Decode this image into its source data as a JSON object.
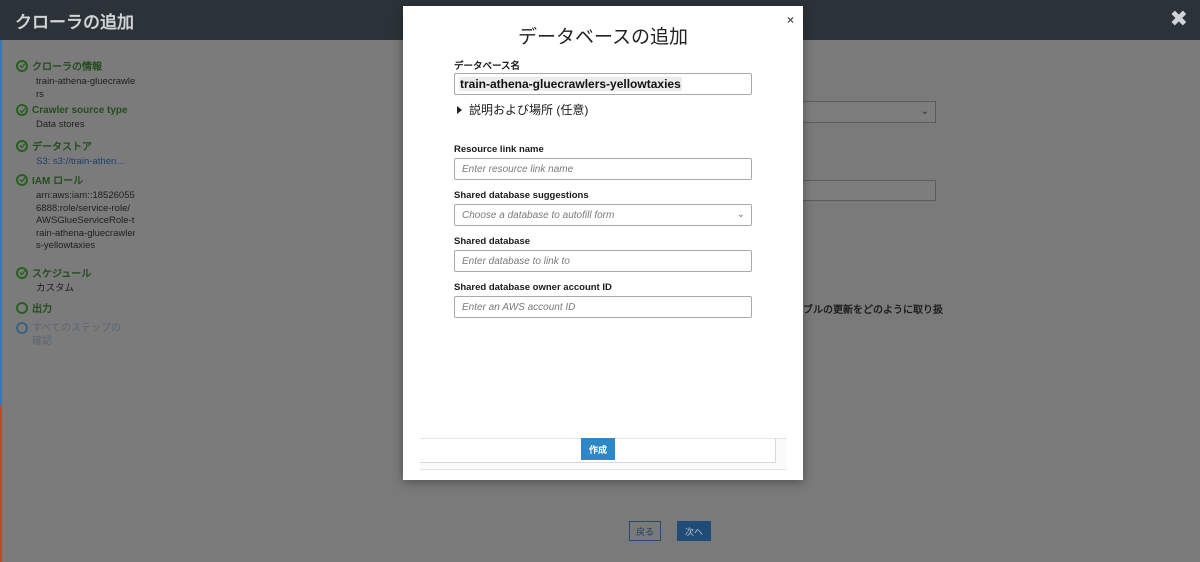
{
  "header": {
    "title": "クローラの追加",
    "close_glyph": "✖"
  },
  "sidebar": {
    "steps": [
      {
        "label": "クローラの情報",
        "detail": "train-athena-gluecrawlers",
        "status": "complete"
      },
      {
        "label": "Crawler source type",
        "detail": "Data stores",
        "status": "complete"
      },
      {
        "label": "データストア",
        "detail": "S3: s3://train-athen…",
        "status": "complete"
      },
      {
        "label": "IAM ロール",
        "detail": "arn:aws:iam::185260556888:role/service-role/AWSGlueServiceRole-train-athena-gluecrawlers-yellowtaxies",
        "status": "complete"
      },
      {
        "label": "スケジュール",
        "detail": "カスタム",
        "status": "complete"
      },
      {
        "label": "出力",
        "detail": "",
        "status": "current"
      },
      {
        "label": "すべてのステップの確認",
        "detail": "",
        "status": "inactive"
      }
    ]
  },
  "background": {
    "partial_text": "ブルの更新をどのように取り扱",
    "back_button": "戻る",
    "next_button": "次へ"
  },
  "modal": {
    "title": "データベースの追加",
    "close_glyph": "×",
    "db_name_label": "データベース名",
    "db_name_value": "train-athena-gluecrawlers-yellowtaxies",
    "expander_label": "説明および場所 (任意)",
    "resource_link_label": "Resource link name",
    "resource_link_placeholder": "Enter resource link name",
    "suggestions_label": "Shared database suggestions",
    "suggestions_placeholder": "Choose a database to autofill form",
    "shared_db_label": "Shared database",
    "shared_db_placeholder": "Enter database to link to",
    "owner_label": "Shared database owner account ID",
    "owner_placeholder": "Enter an AWS account ID",
    "create_button": "作成"
  },
  "colors": {
    "topbar": "#2c3338",
    "overlay": "#7a7a7a",
    "primary_button": "#2f87c8",
    "complete_green": "#2a5f22"
  }
}
